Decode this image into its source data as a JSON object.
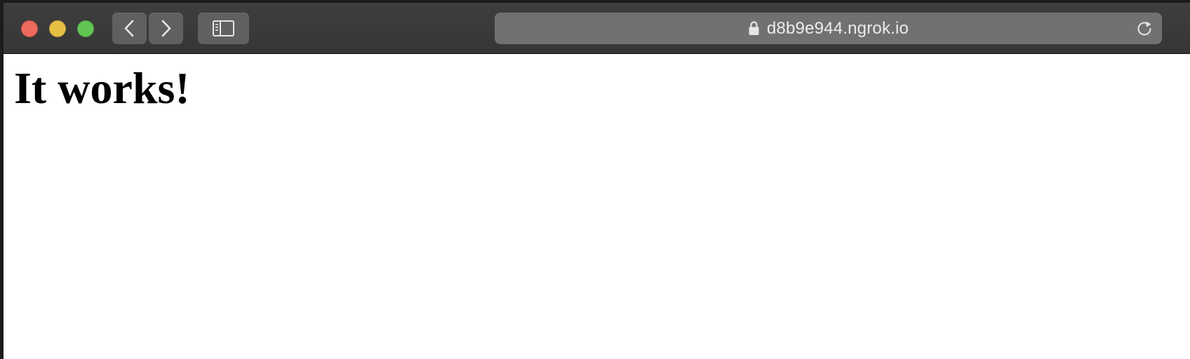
{
  "browser": {
    "address_bar": {
      "url": "d8b9e944.ngrok.io",
      "secure": true
    },
    "icons": {
      "back": "chevron-left-icon",
      "forward": "chevron-right-icon",
      "sidebar": "sidebar-icon",
      "lock": "lock-icon",
      "reload": "reload-icon"
    },
    "colors": {
      "close": "#ed6a5e",
      "minimize": "#e6c045",
      "zoom": "#61c554",
      "toolbar": "#3a3a3a",
      "address_bar": "#717171"
    }
  },
  "page": {
    "heading": "It works!"
  }
}
